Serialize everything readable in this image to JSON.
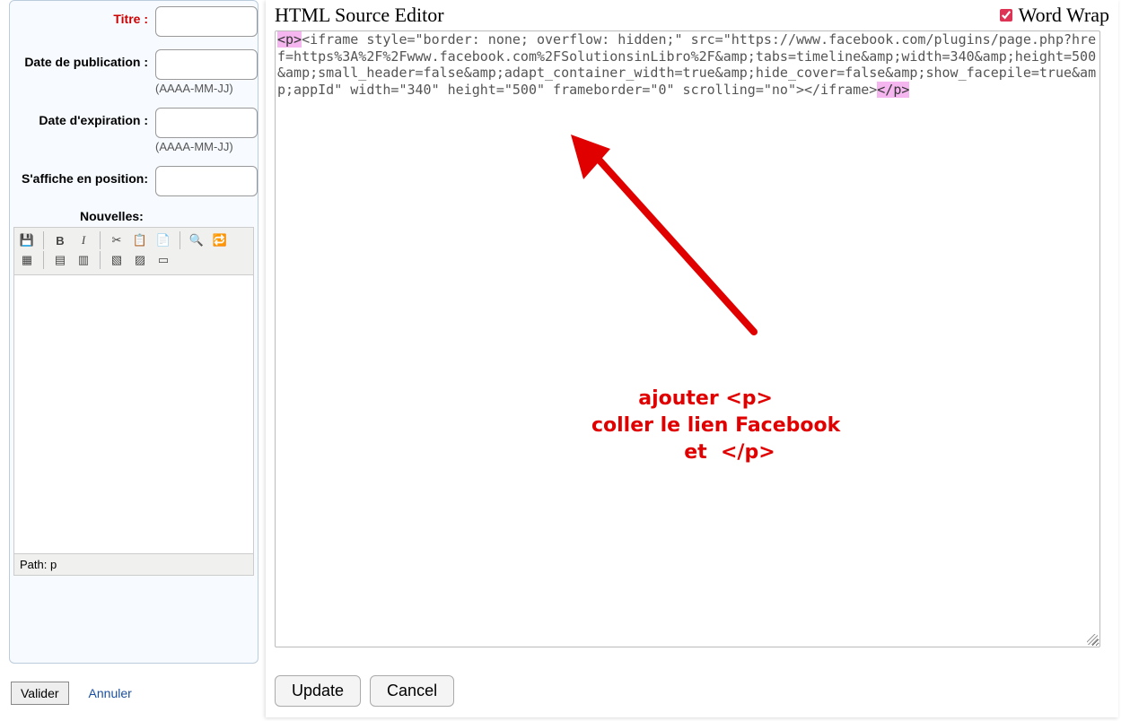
{
  "form": {
    "titre_label": "Titre :",
    "date_pub_label": "Date de publication :",
    "date_exp_label": "Date d'expiration :",
    "date_hint": "(AAAA-MM-JJ)",
    "position_label": "S'affiche en position:",
    "nouvelles_label": "Nouvelles:",
    "titre_value": "",
    "date_pub_value": "",
    "date_exp_value": "",
    "position_value": ""
  },
  "path_bar": {
    "prefix": "Path: ",
    "value": "p"
  },
  "buttons": {
    "valider": "Valider",
    "annuler": "Annuler"
  },
  "modal": {
    "title": "HTML Source Editor",
    "wordwrap_label": "Word Wrap",
    "wordwrap_checked": true,
    "update": "Update",
    "cancel": "Cancel"
  },
  "source_code": {
    "open_tag": "<p>",
    "middle": "<iframe style=\"border: none; overflow: hidden;\" src=\"https://www.facebook.com/plugins/page.php?href=https%3A%2F%2Fwww.facebook.com%2FSolutionsinLibro%2F&amp;tabs=timeline&amp;width=340&amp;height=500&amp;small_header=false&amp;adapt_container_width=true&amp;hide_cover=false&amp;show_facepile=true&amp;appId\" width=\"340\" height=\"500\" frameborder=\"0\" scrolling=\"no\"></iframe>",
    "close_tag": "</p>"
  },
  "annotation": {
    "line1": "ajouter <p>",
    "line2": "   coller le lien Facebook",
    "line3": "       et  </p>"
  },
  "toolbar_icons": {
    "save": "💾",
    "bold": "B",
    "italic": "I",
    "cut": "✂",
    "copy": "📋",
    "paste": "📄",
    "find": "🔍",
    "replace": "🔁",
    "table": "▦",
    "row_before": "▤",
    "row_after": "▥",
    "col_before": "▧",
    "col_after": "▨",
    "merge": "▭"
  }
}
